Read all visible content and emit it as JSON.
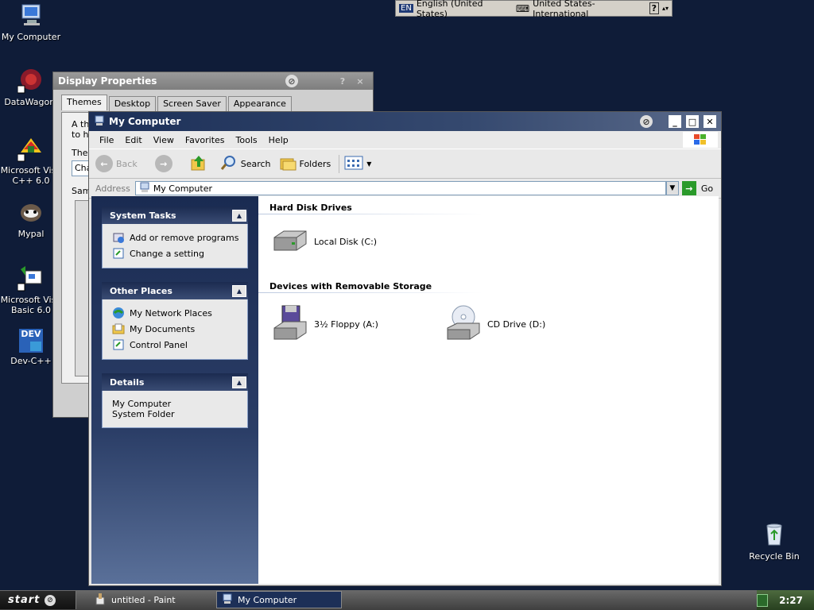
{
  "desktop": {
    "icons": [
      {
        "label": "My Computer"
      },
      {
        "label": "DataWagon."
      },
      {
        "label": "Microsoft Visu\nC++ 6.0"
      },
      {
        "label": "Mypal"
      },
      {
        "label": "Microsoft Visu\nBasic 6.0"
      },
      {
        "label": "Dev-C++"
      },
      {
        "label": "Recycle Bin"
      }
    ],
    "dev_icon_text": "DEV"
  },
  "language_bar": {
    "lang_code": "EN",
    "language": "English (United States)",
    "keyboard": "United States-International",
    "help": "?"
  },
  "display_properties": {
    "title": "Display Properties",
    "help_btn": "?",
    "close_btn": "×",
    "tabs": [
      "Themes",
      "Desktop",
      "Screen Saver",
      "Appearance"
    ],
    "panel_text_1": "A th",
    "panel_text_2": "to he",
    "theme_label": "Ther",
    "theme_value": "Cha",
    "sample_label": "Sam"
  },
  "my_computer": {
    "title": "My Computer",
    "menus": [
      "File",
      "Edit",
      "View",
      "Favorites",
      "Tools",
      "Help"
    ],
    "toolbar": {
      "back": "Back",
      "search": "Search",
      "folders": "Folders"
    },
    "address": {
      "label": "Address",
      "value": "My Computer",
      "go": "Go"
    },
    "system_tasks": {
      "title": "System Tasks",
      "items": [
        "Add or remove programs",
        "Change a setting"
      ]
    },
    "other_places": {
      "title": "Other Places",
      "items": [
        "My Network Places",
        "My Documents",
        "Control Panel"
      ]
    },
    "details": {
      "title": "Details",
      "name": "My Computer",
      "type": "System Folder"
    },
    "hard_disk_title": "Hard Disk Drives",
    "local_disk": "Local Disk (C:)",
    "removable_title": "Devices with Removable Storage",
    "floppy": "3½ Floppy (A:)",
    "cd": "CD Drive (D:)"
  },
  "taskbar": {
    "start": "start",
    "tasks": [
      "untitled - Paint",
      "My Computer"
    ],
    "clock": "2:27"
  },
  "colors": {
    "desktop": "#0f1c38",
    "title_active": "#1c2f57",
    "title_inactive": "#8a8a8a",
    "task_pane": "#2a3d66"
  }
}
